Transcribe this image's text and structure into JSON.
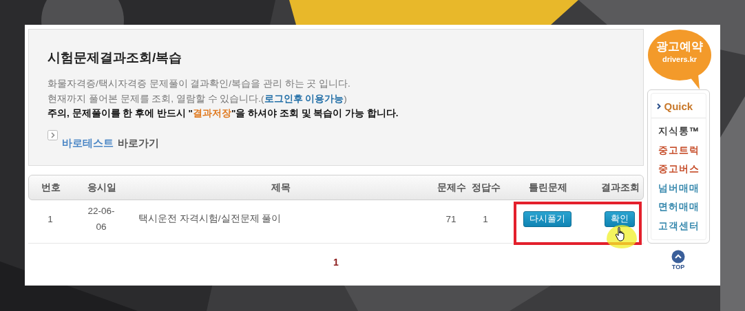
{
  "header": {
    "title": "시험문제결과조회/복습",
    "lines": [
      "화물자격증/택시자격증 문제풀이 결과확인/복습을 관리 하는 곳 입니다.",
      "현재까지 풀어본 문제를 조회, 열람할 수 있습니다.(**로그인후 이용가능**)"
    ],
    "notice": "주의, 문제풀이를 한 후에 반드시 \"**결과저장**\"을 하셔야 조회 및 복습이 가능 합니다.",
    "shortcut": [
      {
        "text": "바로테스트",
        "kind": "accent"
      },
      {
        "text": " 바로가기",
        "kind": "plain"
      }
    ]
  },
  "table": {
    "columns": [
      "번호",
      "응시일",
      "제목",
      "문제수",
      "정답수",
      "틀린문제",
      "결과조회"
    ],
    "rows": [
      {
        "number": "1",
        "date": "22-06-06",
        "title": "택시운전 자격시험/실전문제 풀이",
        "questions": "71",
        "correct": "1",
        "retry_button": "다시풀기",
        "result_button": "확인"
      }
    ]
  },
  "pagination": [
    {
      "label": "1",
      "selected": true
    }
  ],
  "sidebar": {
    "ad": {
      "title": "광고예약",
      "subtitle": "drivers.kr"
    },
    "quick_title": "Quick",
    "quick_links": [
      {
        "label": "지식통™",
        "color": "#333333"
      },
      {
        "label": "중고트럭",
        "color": "#c2401a"
      },
      {
        "label": "중고버스",
        "color": "#c2401a"
      },
      {
        "label": "넘버매매",
        "color": "#2a80a8"
      },
      {
        "label": "면허매매",
        "color": "#2a80a8"
      },
      {
        "label": "고객센터",
        "color": "#2a80a8"
      }
    ],
    "top_button": "TOP"
  }
}
